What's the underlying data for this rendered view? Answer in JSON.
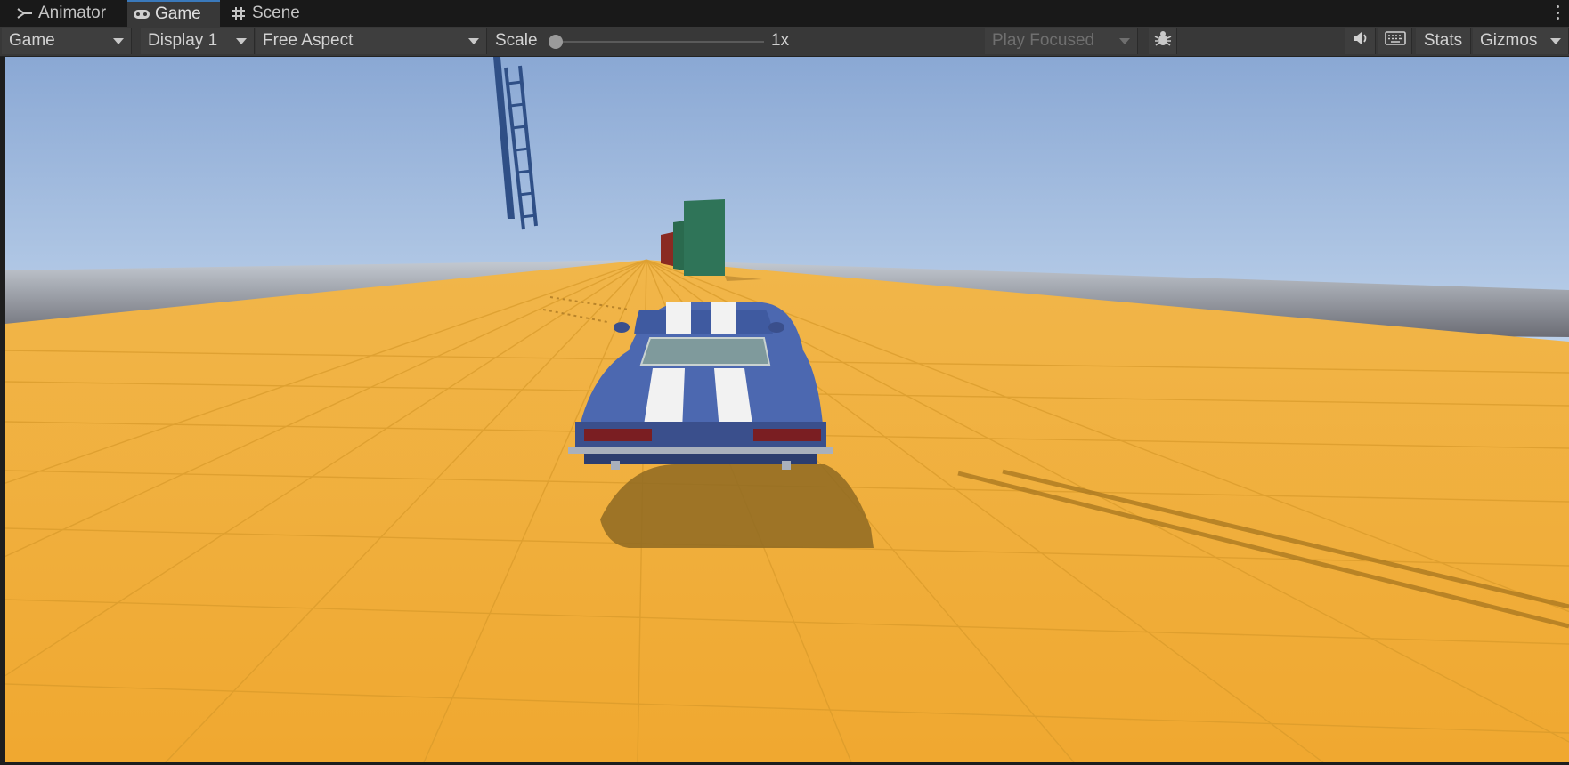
{
  "tabs": [
    {
      "label": "Animator",
      "icon": "animator-icon",
      "active": false
    },
    {
      "label": "Game",
      "icon": "gamepad-icon",
      "active": true
    },
    {
      "label": "Scene",
      "icon": "grid-icon",
      "active": false
    }
  ],
  "toolbar": {
    "view_select": "Game",
    "display_select": "Display 1",
    "aspect_select": "Free Aspect",
    "scale_label": "Scale",
    "scale_value": "1x",
    "play_mode": "Play Focused",
    "stats_label": "Stats",
    "gizmos_label": "Gizmos"
  },
  "icons": {
    "mute": "speaker-icon",
    "keyboard": "keyboard-icon",
    "debug": "bug-icon",
    "menu": "kebab-menu-icon"
  },
  "colors": {
    "accent": "#3a79bb",
    "ground": "#f0b23c",
    "sky_top": "#8aa8d4",
    "car_body": "#4c68b0",
    "stripe": "#ffffff",
    "tower": "#2f7458"
  }
}
